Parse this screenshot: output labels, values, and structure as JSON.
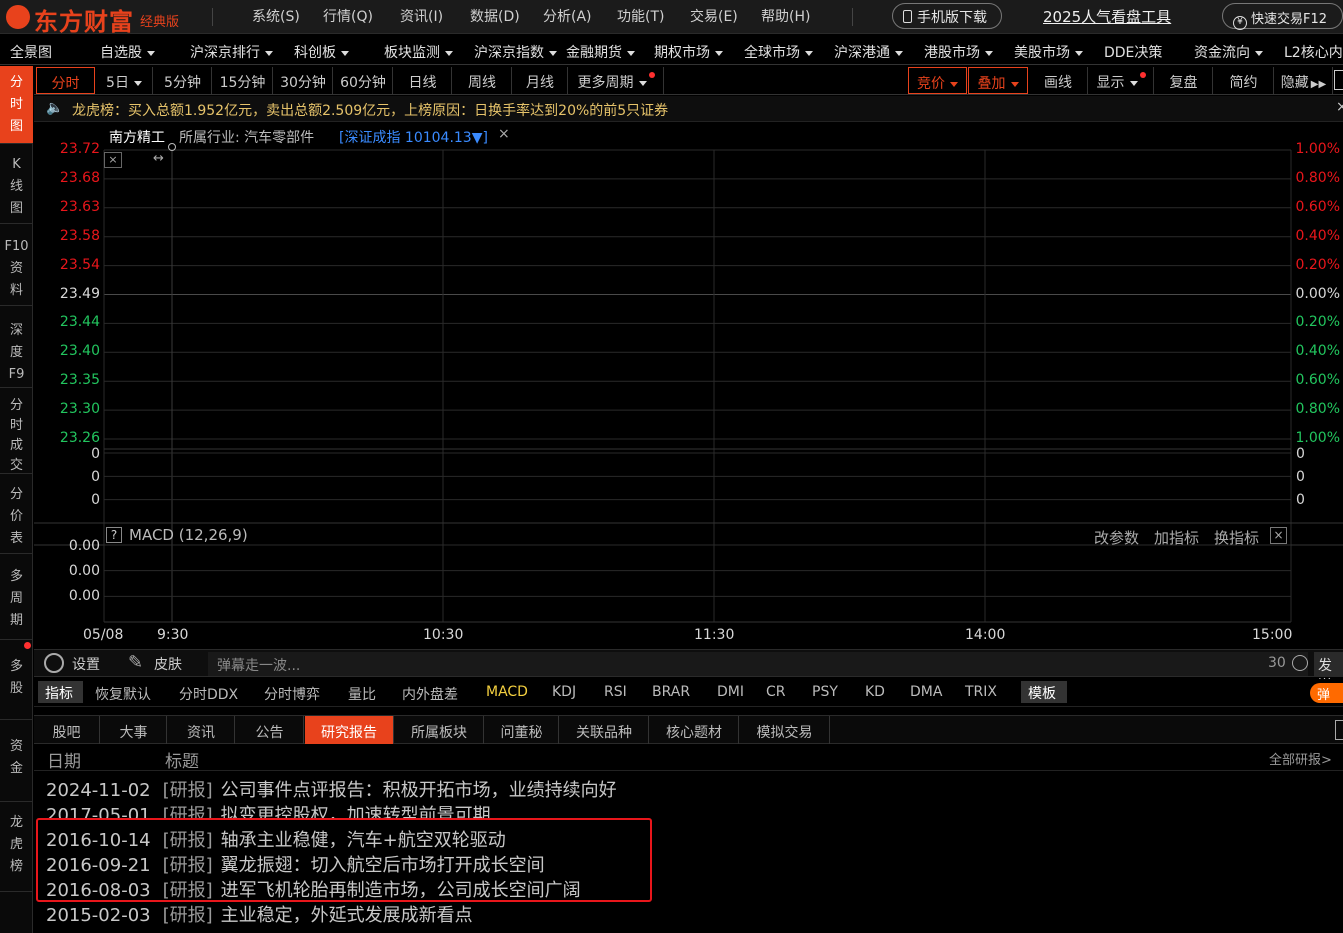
{
  "app": {
    "logo": "东方财富",
    "edition": "经典版",
    "menu": [
      "系统(S)",
      "行情(Q)",
      "资讯(I)",
      "数据(D)",
      "分析(A)",
      "功能(T)",
      "交易(E)",
      "帮助(H)"
    ],
    "mobile_download": "手机版下载",
    "promo_link": "2025人气看盘工具",
    "quick_trade": "快速交易F12"
  },
  "nav": {
    "items": [
      "全景图",
      "自选股",
      "沪深京排行",
      "科创板",
      "板块监测",
      "沪深京指数",
      "金融期货",
      "期权市场",
      "全球市场",
      "沪深港通",
      "港股市场",
      "美股市场",
      "DDE决策",
      "资金流向",
      "L2核心内"
    ]
  },
  "sidebar": {
    "items": [
      "分时图",
      "K线图",
      "F10资料",
      "深度F9",
      "分时成交",
      "分价表",
      "多周期",
      "多股",
      "资金",
      "龙虎榜"
    ]
  },
  "timeframes": {
    "items": [
      "分时",
      "5日",
      "5分钟",
      "15分钟",
      "30分钟",
      "60分钟",
      "日线",
      "周线",
      "月线",
      "更多周期"
    ],
    "right": [
      "竞价",
      "叠加",
      "画线",
      "显示",
      "复盘",
      "简约",
      "隐藏"
    ]
  },
  "notice": {
    "text": "龙虎榜：买入总额1.952亿元，卖出总额2.509亿元，上榜原因：日换手率达到20%的前5只证券"
  },
  "stock": {
    "name": "南方精工",
    "industry": "所属行业: 汽车零部件",
    "index": "[深证成指 10104.13▼]"
  },
  "chart_data": {
    "type": "line",
    "title": "南方精工",
    "date": "05/08",
    "x_ticks": [
      "9:30",
      "10:30",
      "11:30",
      "14:00",
      "15:00"
    ],
    "price_ticks": [
      "23.72",
      "23.68",
      "23.63",
      "23.58",
      "23.54",
      "23.49",
      "23.44",
      "23.40",
      "23.35",
      "23.30",
      "23.26"
    ],
    "pct_ticks": [
      "1.00%",
      "0.80%",
      "0.60%",
      "0.40%",
      "0.20%",
      "0.00%",
      "0.20%",
      "0.40%",
      "0.60%",
      "0.80%",
      "1.00%"
    ],
    "volume_ticks": [
      "0",
      "0",
      "0"
    ],
    "volume_ticks_right": [
      "0",
      "0",
      "0"
    ],
    "macd_label": "MACD (12,26,9)",
    "macd_ticks": [
      "0.00",
      "0.00",
      "0.00"
    ],
    "macd_actions": [
      "改参数",
      "加指标",
      "换指标"
    ],
    "series": []
  },
  "toolrow": {
    "settings": "设置",
    "skin": "皮肤",
    "danmu_placeholder": "弹幕走一波...",
    "count": "30",
    "send": "发送"
  },
  "indicators": {
    "items": [
      "指标",
      "恢复默认",
      "分时DDX",
      "分时博弈",
      "量比",
      "内外盘差",
      "MACD",
      "KDJ",
      "RSI",
      "BRAR",
      "DMI",
      "CR",
      "PSY",
      "KD",
      "DMA",
      "TRIX",
      "模板"
    ],
    "popup": "弹"
  },
  "info_tabs": {
    "items": [
      "股吧",
      "大事",
      "资讯",
      "公告",
      "研究报告",
      "所属板块",
      "问董秘",
      "关联品种",
      "核心题材",
      "模拟交易"
    ],
    "active": "研究报告"
  },
  "reports": {
    "col_date": "日期",
    "col_title": "标题",
    "more": "全部研报>",
    "rows": [
      {
        "date": "2024-11-02",
        "tag": "[研报]",
        "title": "公司事件点评报告：积极开拓市场，业绩持续向好"
      },
      {
        "date": "2017-05-01",
        "tag": "[研报]",
        "title": "拟变更控股权，加速转型前景可期"
      },
      {
        "date": "2016-10-14",
        "tag": "[研报]",
        "title": "轴承主业稳健，汽车+航空双轮驱动"
      },
      {
        "date": "2016-09-21",
        "tag": "[研报]",
        "title": "翼龙振翅：切入航空后市场打开成长空间"
      },
      {
        "date": "2016-08-03",
        "tag": "[研报]",
        "title": "进军飞机轮胎再制造市场，公司成长空间广阔"
      },
      {
        "date": "2015-02-03",
        "tag": "[研报]",
        "title": "主业稳定，外延式发展成新看点"
      }
    ]
  },
  "colors": {
    "accent": "#e8421c",
    "up": "#e8161b",
    "down": "#22c55e",
    "neutral": "#c8c8c8",
    "highlight_box": "#e8161b"
  }
}
